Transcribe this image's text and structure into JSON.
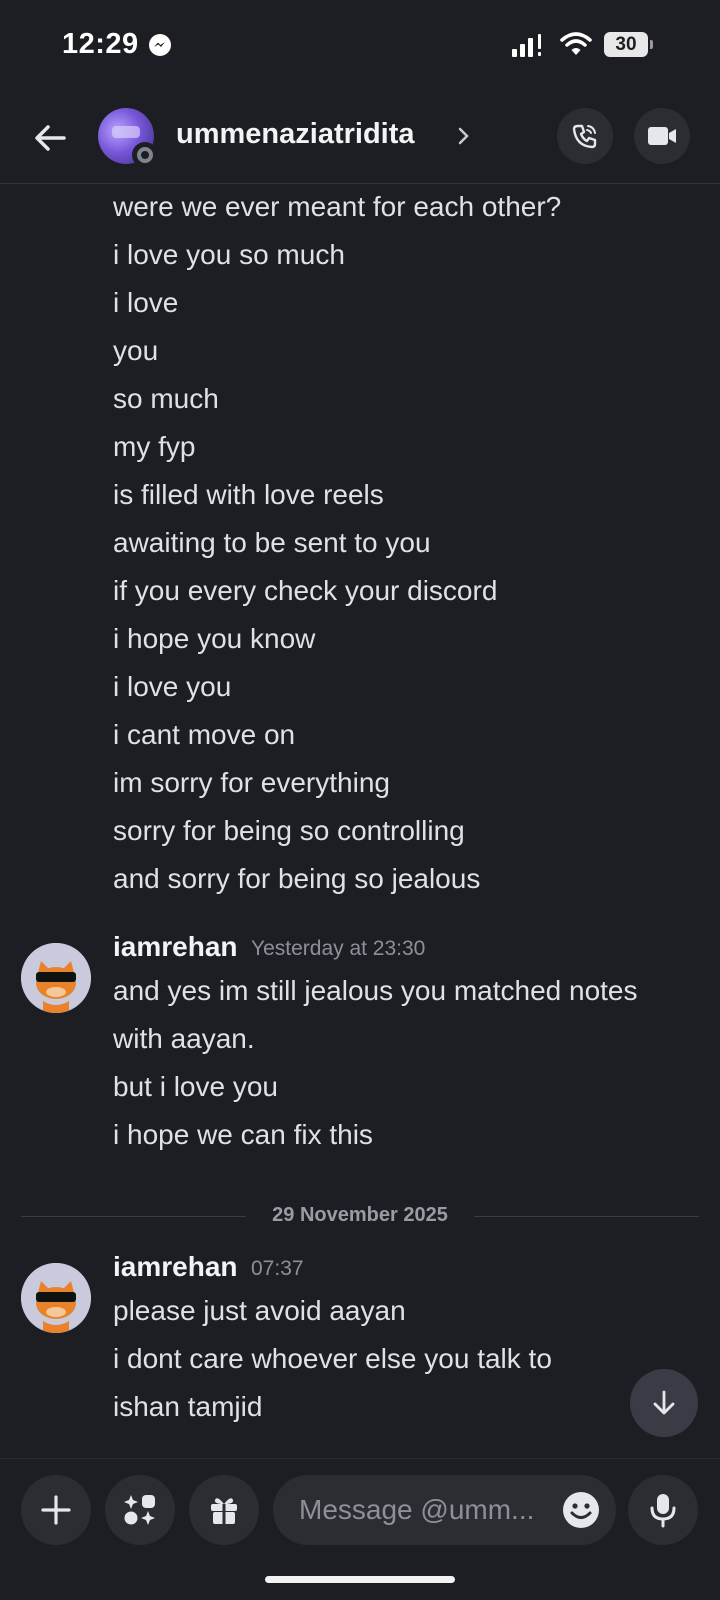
{
  "status_bar": {
    "time": "12:29",
    "battery": "30"
  },
  "header": {
    "username": "ummenaziatridita"
  },
  "messages": {
    "continued_lines": [
      "were we ever meant for each other?",
      "i love you so much",
      "i love",
      "you",
      "so much",
      "my fyp",
      "is filled with love reels",
      "awaiting to be sent to you",
      "if you every check your discord",
      "i hope you know",
      "i love you",
      "i cant move on",
      "im sorry for everything",
      "sorry for being so controlling",
      "and sorry for being so jealous"
    ],
    "group1": {
      "author": "iamrehan",
      "timestamp": "Yesterday at 23:30",
      "lines": [
        "and yes im still jealous you matched notes",
        "with aayan.",
        "but i love you",
        "i hope we can fix this"
      ]
    },
    "date_divider": "29 November 2025",
    "group2": {
      "author": "iamrehan",
      "timestamp": "07:37",
      "lines": [
        "please just avoid aayan",
        "i dont care whoever else you talk to",
        "ishan tamjid"
      ]
    }
  },
  "composer": {
    "placeholder": "Message @umm..."
  },
  "icons": {
    "back": "arrow-left-icon",
    "call": "phone-icon",
    "video": "video-camera-icon",
    "plus": "plus-icon",
    "apps": "apps-icon",
    "gift": "gift-icon",
    "emoji": "emoji-icon",
    "mic": "microphone-icon",
    "scroll": "arrow-down-icon"
  },
  "colors": {
    "background": "#1d1e24",
    "button_bg": "#2b2d33",
    "text": "#e0e1e5",
    "muted": "#8e9099"
  }
}
